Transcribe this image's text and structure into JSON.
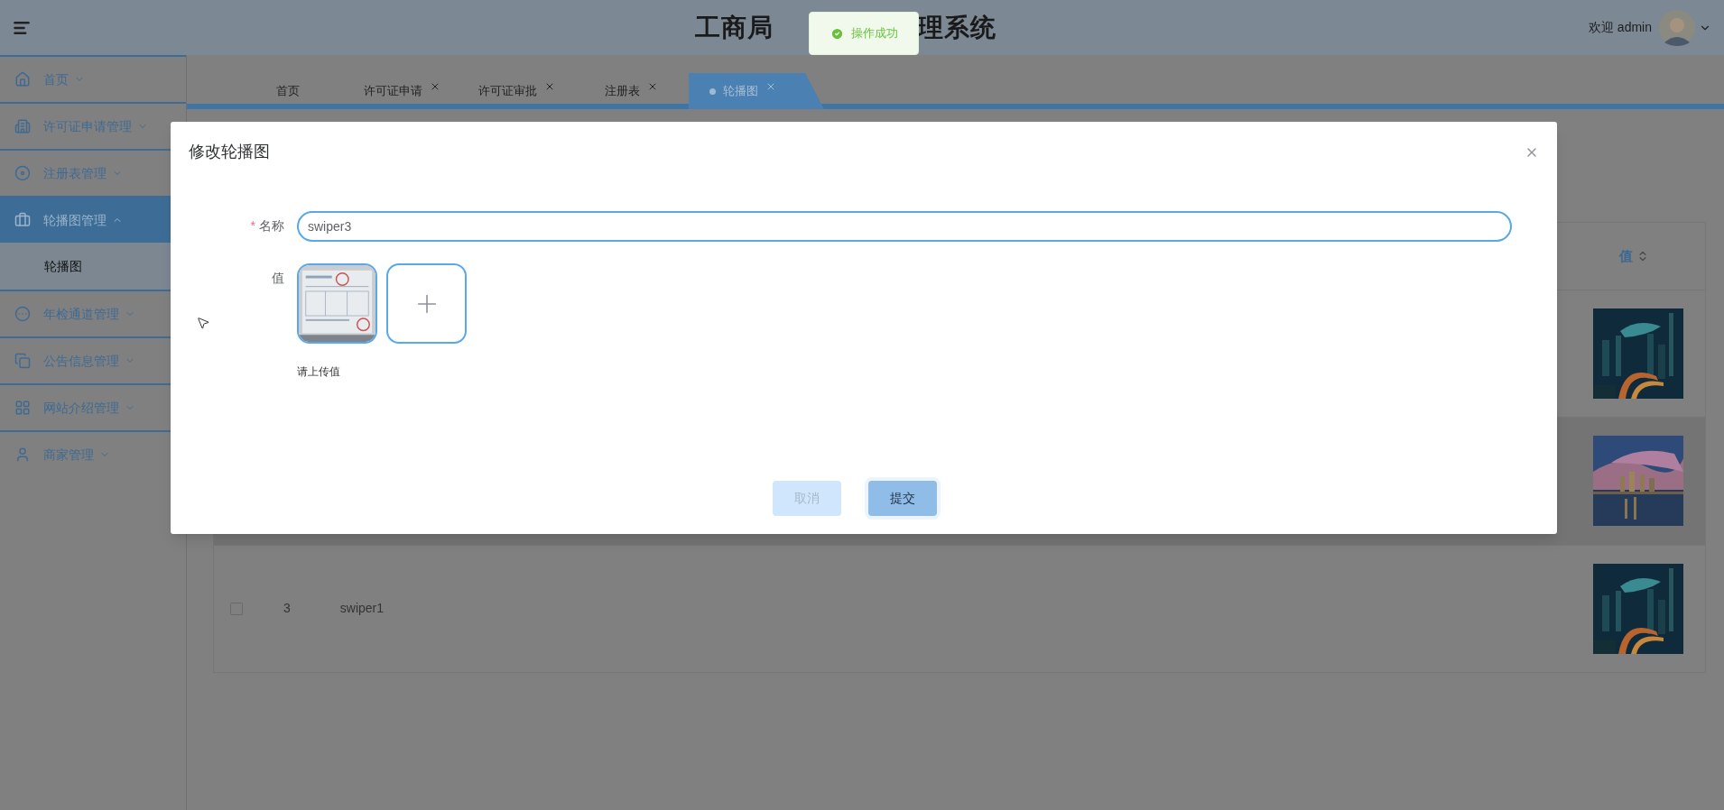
{
  "header": {
    "title_parts": [
      "工商局",
      "理系统"
    ],
    "welcome": "欢迎 admin"
  },
  "toast": {
    "kind": "success",
    "message": "操作成功"
  },
  "sidebar": {
    "items": [
      {
        "label": "首页",
        "expanded": false,
        "selected": false
      },
      {
        "label": "许可证申请管理",
        "expanded": false,
        "selected": false
      },
      {
        "label": "注册表管理",
        "expanded": false,
        "selected": false
      },
      {
        "label": "轮播图管理",
        "expanded": true,
        "selected": true,
        "children": [
          {
            "label": "轮播图",
            "selected": true
          }
        ]
      },
      {
        "label": "年检通道管理",
        "expanded": false,
        "selected": false
      },
      {
        "label": "公告信息管理",
        "expanded": false,
        "selected": false
      },
      {
        "label": "网站介绍管理",
        "expanded": false,
        "selected": false
      },
      {
        "label": "商家管理",
        "expanded": false,
        "selected": false
      }
    ]
  },
  "tabs": [
    {
      "label": "首页",
      "closable": false,
      "selected": false
    },
    {
      "label": "许可证申请",
      "closable": true,
      "selected": false
    },
    {
      "label": "许可证审批",
      "closable": true,
      "selected": false
    },
    {
      "label": "注册表",
      "closable": true,
      "selected": false
    },
    {
      "label": "轮播图",
      "closable": true,
      "selected": true
    }
  ],
  "table": {
    "columns": [
      {
        "label": "值",
        "sortable": true
      }
    ],
    "rows": [
      {
        "highlighted": false
      },
      {
        "highlighted": true
      },
      {
        "highlighted": false,
        "checked": false,
        "index": "3",
        "name": "swiper1"
      }
    ]
  },
  "dialog": {
    "title": "修改轮播图",
    "fields": [
      {
        "kind": "text",
        "required_mark": "*",
        "label": "名称",
        "value": "swiper3"
      },
      {
        "kind": "upload",
        "label": "值",
        "hint": "请上传值"
      }
    ],
    "buttons": [
      {
        "kind": "cancel",
        "label": "取消",
        "disabled": true
      },
      {
        "kind": "primary",
        "label": "提交",
        "disabled": false
      }
    ]
  }
}
